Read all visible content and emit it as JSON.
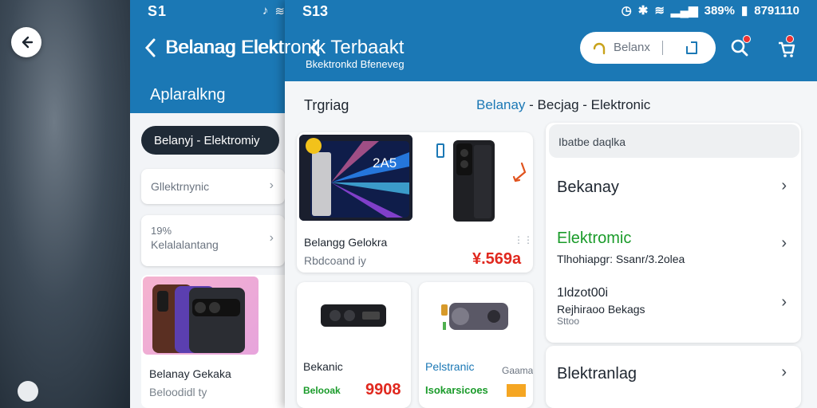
{
  "back_screen": {
    "status_time": "S1",
    "title": "Belanag Elektronik Terbaakt",
    "subtitle_tab": "Aplaralkng",
    "chip": "Belanyj - Elektromiy",
    "card1": "Gllektrnynic",
    "card2_line1": "19%",
    "card2_line2": "Kelalalantang",
    "product_name": "Belanay Gekaka",
    "product_sub": "Beloodidl ty"
  },
  "front_screen": {
    "status_time": "S13",
    "status_battery": "389%",
    "status_clock": "8791110",
    "title": "Belanag Elektronik Terbaakt",
    "subtitle": "Bkektronkd Bfeneveg",
    "search_placeholder": "Belanx"
  },
  "main": {
    "section_title": "Trgriag",
    "breadcrumb_1": "Belanay",
    "breadcrumb_sep": " - ",
    "breadcrumb_2": "Becjag",
    "breadcrumb_sep2": " - ",
    "breadcrumb_3": "Elektronic",
    "featured": {
      "tablet_text": "2A5",
      "name": "Belangg Gelokra",
      "sub": "Rbdcoand iy",
      "price": "¥.569a"
    },
    "card_a": {
      "name": "Bekanic",
      "sub": "Belooak",
      "price": "9908"
    },
    "card_b": {
      "name": "Pelstranic",
      "sub": "Isokarsicoes",
      "tag": "Gaama"
    }
  },
  "right_panel": {
    "search_label": "Ibatbe daqlka",
    "row1": "Bekanay",
    "row2_title": "Elektromic",
    "row2_sub": "Tlhohiapgr: Ssanr/3.2olea",
    "row3_line1": "1ldzot00i",
    "row3_line2": "Rejhiraoo Bekags",
    "row3_line3": "Sttoo",
    "row4": "Blektranlag"
  },
  "colors": {
    "accent": "#1b78b5",
    "price": "#e0281e",
    "green": "#1a9b2a"
  }
}
